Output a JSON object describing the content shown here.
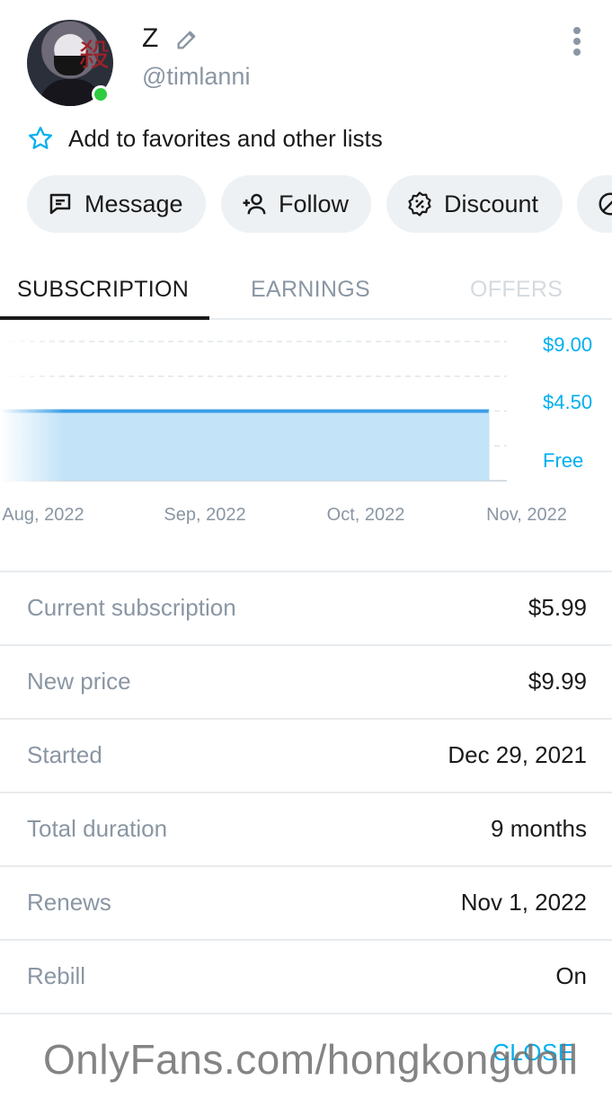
{
  "profile": {
    "name": "Z",
    "handle": "@timlanni",
    "online": true,
    "favorites_label": "Add to favorites and other lists"
  },
  "actions": [
    {
      "label": "Message",
      "icon": "message-icon"
    },
    {
      "label": "Follow",
      "icon": "follow-icon"
    },
    {
      "label": "Discount",
      "icon": "discount-icon"
    },
    {
      "label": "",
      "icon": "block-icon"
    }
  ],
  "tabs": [
    {
      "label": "SUBSCRIPTION",
      "state": "active"
    },
    {
      "label": "EARNINGS",
      "state": "inactive"
    },
    {
      "label": "OFFERS",
      "state": "disabled"
    }
  ],
  "chart_data": {
    "type": "area",
    "x": [
      "Aug, 2022",
      "Sep, 2022",
      "Oct, 2022",
      "Nov, 2022"
    ],
    "series": [
      {
        "values": [
          4.5,
          4.5,
          4.5,
          4.5
        ]
      }
    ],
    "y_tick_labels": [
      "$9.00",
      "$4.50",
      "Free"
    ],
    "ylim": [
      0,
      9
    ],
    "grid": true,
    "colors": {
      "line": "#3a9ee4",
      "fill": "#c2e3f8",
      "tick": "#00aff0",
      "xtick": "#8a96a3"
    }
  },
  "details": [
    {
      "label": "Current subscription",
      "value": "$5.99"
    },
    {
      "label": "New price",
      "value": "$9.99"
    },
    {
      "label": "Started",
      "value": "Dec 29, 2021"
    },
    {
      "label": "Total duration",
      "value": "9 months"
    },
    {
      "label": "Renews",
      "value": "Nov 1, 2022"
    },
    {
      "label": "Rebill",
      "value": "On"
    }
  ],
  "footer": {
    "close_label": "CLOSE"
  },
  "watermark": "OnlyFans.com/hongkongdoll",
  "colors": {
    "accent": "#00aff0",
    "muted": "#8a96a3",
    "online": "#2ecc40",
    "pill": "#eef1f3"
  }
}
